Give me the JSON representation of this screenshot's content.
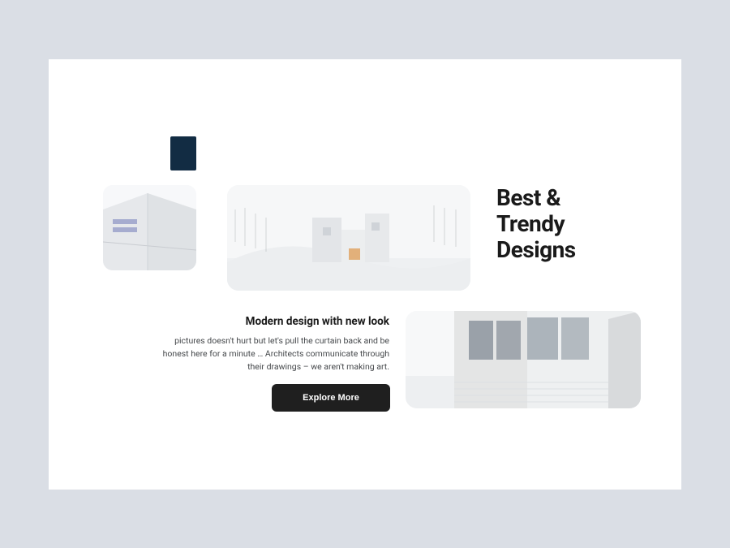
{
  "hero": {
    "title_line1": "Best &",
    "title_line2": "Trendy",
    "title_line3": "Designs"
  },
  "content": {
    "subtitle": "Modern design with new look",
    "body": "pictures doesn't hurt but let's pull the curtain back and be honest here for a minute … Architects communicate through their drawings – we aren't making art.",
    "cta_label": "Explore More"
  },
  "accent": {
    "color": "#122c43"
  }
}
